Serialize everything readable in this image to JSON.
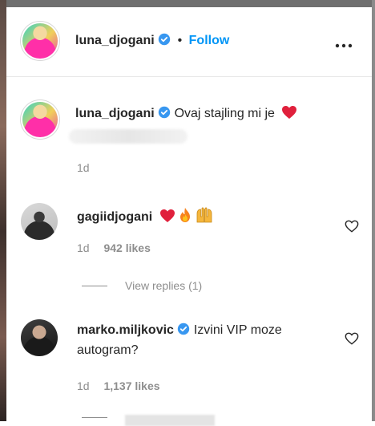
{
  "post": {
    "author": {
      "username": "luna_djogani",
      "verified": true
    },
    "follow_label": "Follow",
    "separator": "•"
  },
  "caption": {
    "username": "luna_djogani",
    "verified": true,
    "text": "Ovaj stajling mi je",
    "emoji": "❤️",
    "time": "1d"
  },
  "comments": [
    {
      "username": "gagiidjogani",
      "verified": false,
      "text": "",
      "emojis": "❤️🔥🙌",
      "time": "1d",
      "likes": "942 likes",
      "replies_label": "View replies (1)"
    },
    {
      "username": "marko.miljkovic",
      "verified": true,
      "text_line1": "Izvini VIP moze",
      "text_line2": "autogram?",
      "time": "1d",
      "likes": "1,137 likes"
    }
  ],
  "colors": {
    "link_blue": "#0095f6",
    "verified_blue": "#3897f0",
    "muted": "#8e8e8e",
    "heart_red": "#e0203c"
  },
  "icons": [
    "verified-badge-icon",
    "more-options-icon",
    "like-heart-icon"
  ]
}
